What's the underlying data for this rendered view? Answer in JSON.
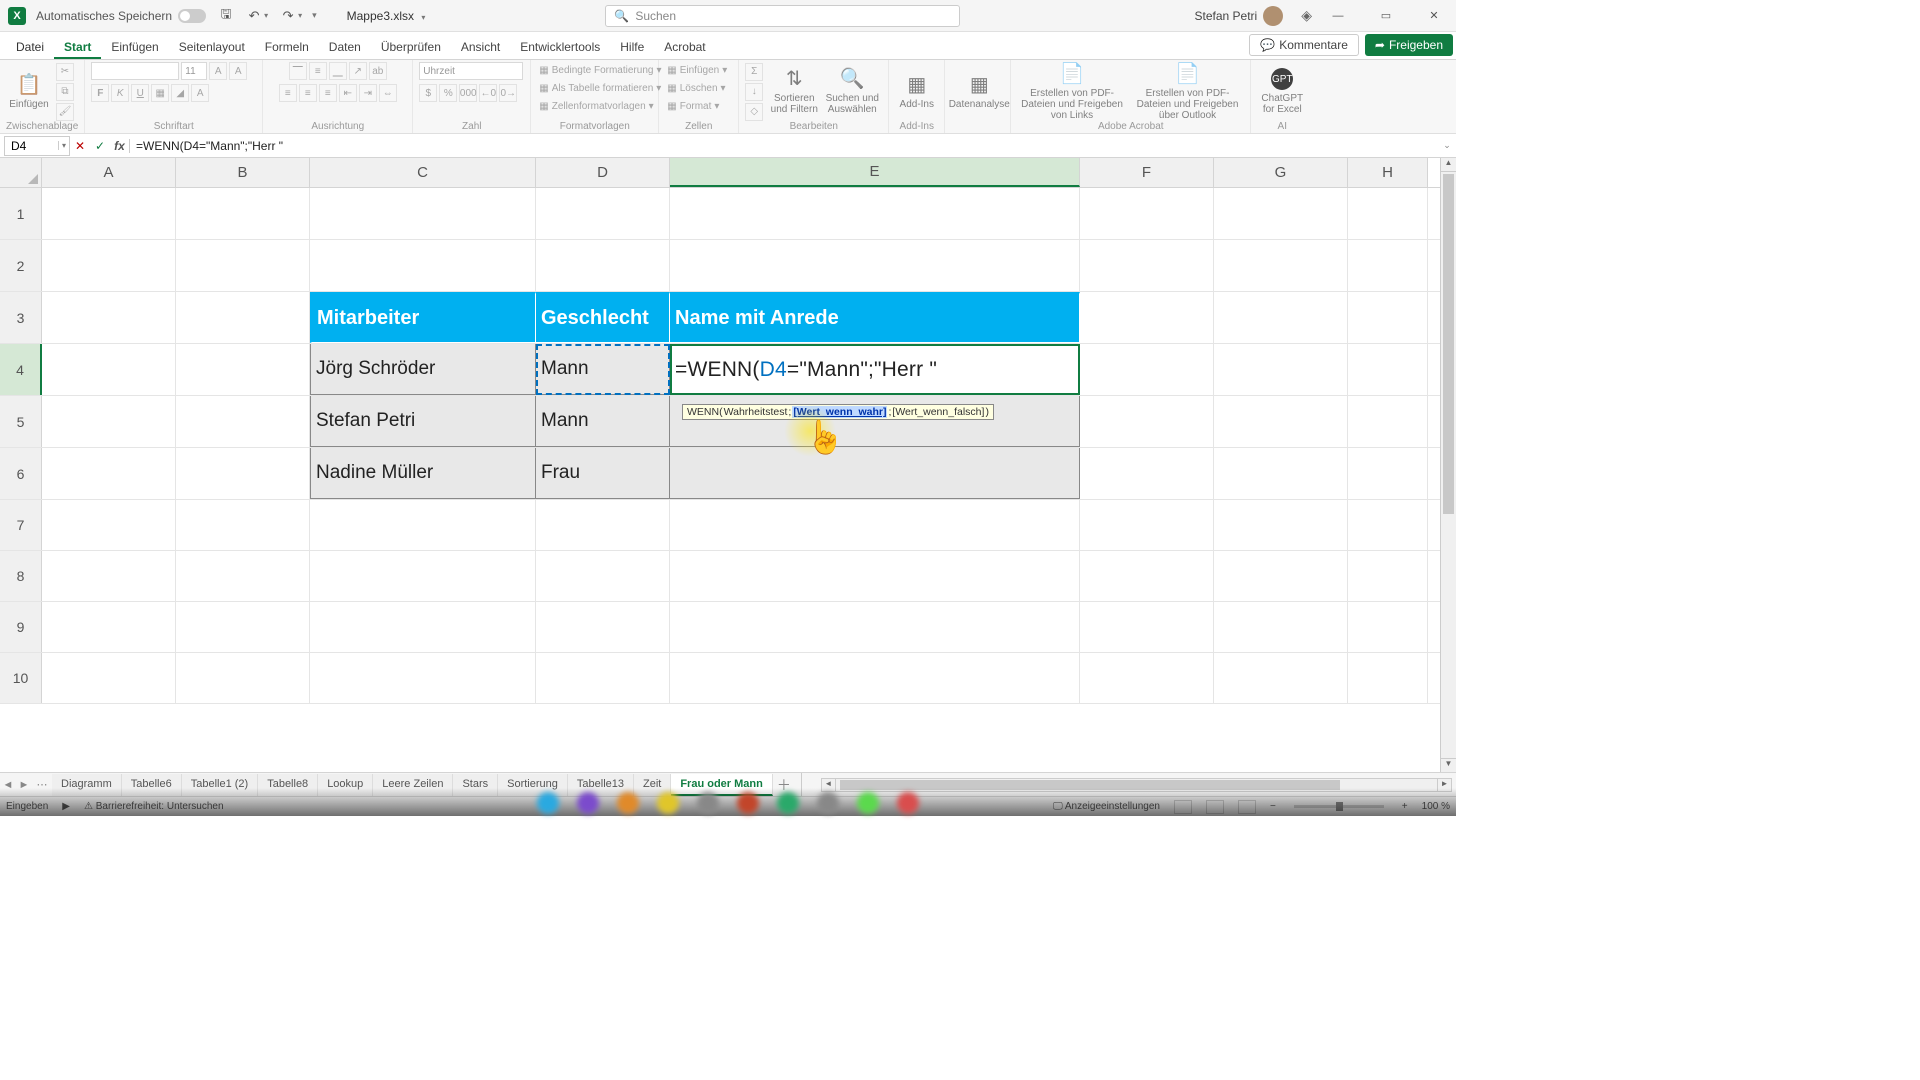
{
  "titlebar": {
    "autosave": "Automatisches Speichern",
    "filename": "Mappe3.xlsx",
    "search_placeholder": "Suchen",
    "user": "Stefan Petri"
  },
  "tabs": {
    "file": "Datei",
    "start": "Start",
    "einfuegen": "Einfügen",
    "seitenlayout": "Seitenlayout",
    "formeln": "Formeln",
    "daten": "Daten",
    "ueberpruefen": "Überprüfen",
    "ansicht": "Ansicht",
    "entwicklertools": "Entwicklertools",
    "hilfe": "Hilfe",
    "acrobat": "Acrobat",
    "comments": "Kommentare",
    "share": "Freigeben"
  },
  "ribbon": {
    "clipboard": {
      "paste": "Einfügen",
      "label": "Zwischenablage"
    },
    "font": {
      "label": "Schriftart",
      "name_placeholder": "",
      "size_placeholder": "11"
    },
    "alignment": {
      "label": "Ausrichtung"
    },
    "number": {
      "label": "Zahl",
      "format_placeholder": "Uhrzeit"
    },
    "styles": {
      "cond": "Bedingte Formatierung",
      "table": "Als Tabelle formatieren",
      "cell": "Zellenformatvorlagen",
      "label": "Formatvorlagen"
    },
    "cells": {
      "insert": "Einfügen",
      "delete": "Löschen",
      "format": "Format",
      "label": "Zellen"
    },
    "editing": {
      "sort": "Sortieren und Filtern",
      "find": "Suchen und Auswählen",
      "label": "Bearbeiten"
    },
    "addins": {
      "addin": "Add-Ins",
      "label": "Add-Ins"
    },
    "analysis": {
      "btn": "Datenanalyse"
    },
    "acrobat": {
      "pdf_links": "Erstellen von PDF-Dateien und Freigeben von Links",
      "pdf_outlook": "Erstellen von PDF-Dateien und Freigeben über Outlook",
      "label": "Adobe Acrobat"
    },
    "ai": {
      "gpt": "ChatGPT for Excel",
      "label": "AI"
    }
  },
  "fxbar": {
    "namebox": "D4",
    "formula": "=WENN(D4=\"Mann\";\"Herr \""
  },
  "columns": [
    "A",
    "B",
    "C",
    "D",
    "E",
    "F",
    "G",
    "H"
  ],
  "rows": [
    "1",
    "2",
    "3",
    "4",
    "5",
    "6",
    "7",
    "8",
    "9",
    "10"
  ],
  "table": {
    "headers": {
      "mitarbeiter": "Mitarbeiter",
      "geschlecht": "Geschlecht",
      "anrede": "Name mit Anrede"
    },
    "rows": [
      {
        "name": "Jörg Schröder",
        "gender": "Mann"
      },
      {
        "name": "Stefan Petri",
        "gender": "Mann"
      },
      {
        "name": "Nadine Müller",
        "gender": "Frau"
      }
    ],
    "formula_plain_prefix": "=WENN(",
    "formula_ref": "D4",
    "formula_plain_suffix": "=\"Mann\";\"Herr \""
  },
  "tooltip": {
    "func": "WENN(",
    "arg1": "Wahrheitstest",
    "sep1": "; ",
    "arg2": "[Wert_wenn_wahr]",
    "sep2": "; ",
    "arg3": "[Wert_wenn_falsch]",
    "close": ")"
  },
  "sheets": {
    "list": [
      "Diagramm",
      "Tabelle6",
      "Tabelle1 (2)",
      "Tabelle8",
      "Lookup",
      "Leere Zeilen",
      "Stars",
      "Sortierung",
      "Tabelle13",
      "Zeit",
      "Frau oder Mann"
    ],
    "active_index": 10
  },
  "status": {
    "mode": "Eingeben",
    "accessibility": "Barrierefreiheit: Untersuchen",
    "display": "Anzeigeeinstellungen",
    "zoom": "100 %"
  }
}
